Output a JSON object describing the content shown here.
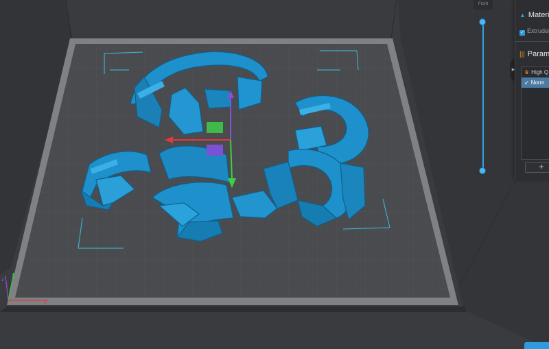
{
  "view": {
    "label": "Front"
  },
  "panel": {
    "material_title": "Materi",
    "extruder_label": "Extruder",
    "params_title": "Param",
    "profiles": [
      {
        "label": "High Q",
        "icon": "crown-icon",
        "selected": false
      },
      {
        "label": "Norm",
        "icon": "rocket-icon",
        "selected": true
      }
    ],
    "add_label": "+"
  },
  "colors": {
    "accent": "#2e9be0",
    "model": "#1d8fc9",
    "bed": "#4b4c50",
    "background": "#3a3b3e"
  }
}
